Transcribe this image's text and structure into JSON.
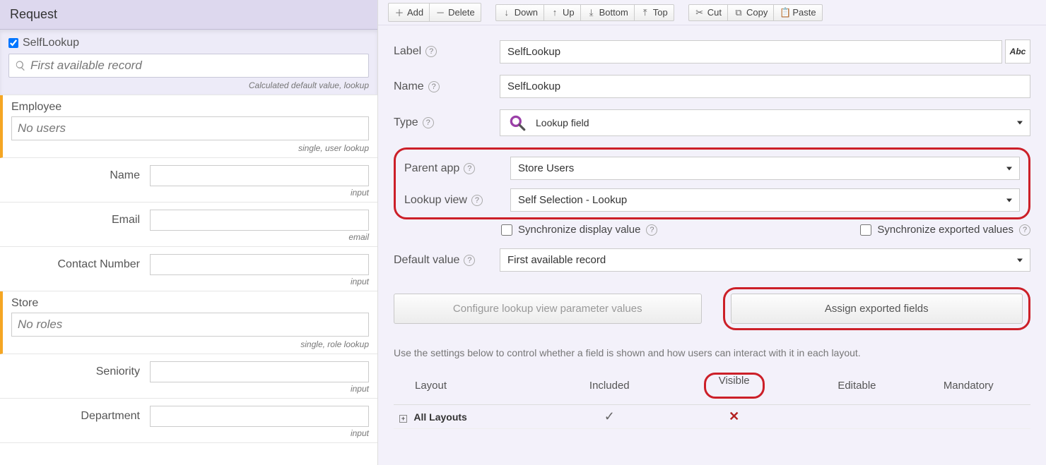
{
  "left": {
    "header": "Request",
    "self_lookup": {
      "title": "SelfLookup",
      "placeholder": "First available record",
      "sub": "Calculated default value, lookup"
    },
    "employee": {
      "title": "Employee",
      "placeholder": "No users",
      "sub": "single, user lookup"
    },
    "rows": [
      {
        "label": "Name",
        "sub": "input"
      },
      {
        "label": "Email",
        "sub": "email"
      },
      {
        "label": "Contact Number",
        "sub": "input"
      }
    ],
    "store": {
      "title": "Store",
      "placeholder": "No roles",
      "sub": "single, role lookup"
    },
    "rows2": [
      {
        "label": "Seniority",
        "sub": "input"
      },
      {
        "label": "Department",
        "sub": "input"
      }
    ]
  },
  "toolbar": {
    "add": "Add",
    "delete": "Delete",
    "down": "Down",
    "up": "Up",
    "bottom": "Bottom",
    "top": "Top",
    "cut": "Cut",
    "copy": "Copy",
    "paste": "Paste"
  },
  "form": {
    "label": {
      "lbl": "Label",
      "val": "SelfLookup",
      "abc": "Abc"
    },
    "name": {
      "lbl": "Name",
      "val": "SelfLookup"
    },
    "type": {
      "lbl": "Type",
      "val": "Lookup field"
    },
    "parent_app": {
      "lbl": "Parent app",
      "val": "Store Users"
    },
    "lookup_view": {
      "lbl": "Lookup view",
      "val": "Self Selection - Lookup"
    },
    "sync_display": "Synchronize display value",
    "sync_export": "Synchronize exported values",
    "default_value": {
      "lbl": "Default value",
      "val": "First available record"
    },
    "btn_configure": "Configure lookup view parameter values",
    "btn_assign": "Assign exported fields",
    "hint": "Use the settings below to control whether a field is shown and how users can interact with it in each layout.",
    "table": {
      "headers": [
        "Layout",
        "Included",
        "Visible",
        "Editable",
        "Mandatory"
      ],
      "row_label": "All Layouts",
      "included": "✓",
      "visible": "✕"
    }
  }
}
